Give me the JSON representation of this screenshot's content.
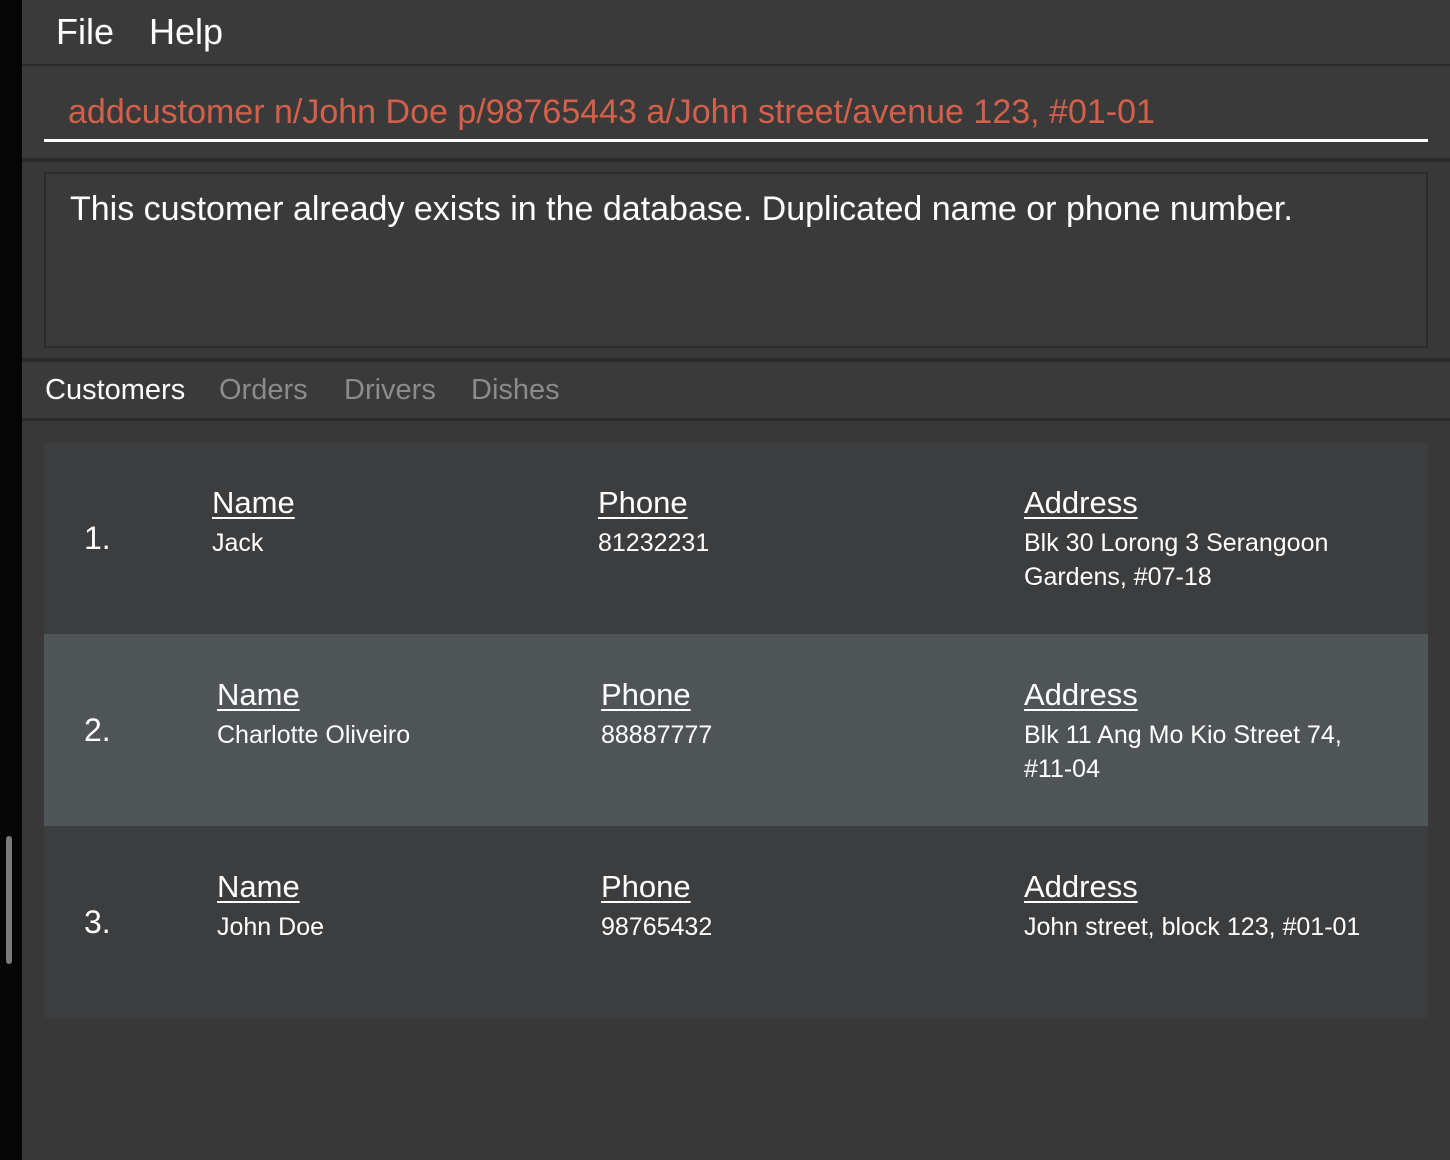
{
  "menu": {
    "file_label": "File",
    "help_label": "Help"
  },
  "command": {
    "value": "addcustomer n/John Doe p/98765443 a/John street/avenue 123, #01-01"
  },
  "result": {
    "message": "This customer already exists in the database. Duplicated name or phone number."
  },
  "tabs": [
    {
      "label": "Customers",
      "active": true
    },
    {
      "label": "Orders",
      "active": false
    },
    {
      "label": "Drivers",
      "active": false
    },
    {
      "label": "Dishes",
      "active": false
    }
  ],
  "headers": {
    "name": "Name",
    "phone": "Phone",
    "address": "Address"
  },
  "customers": [
    {
      "index": "1.",
      "name": "Jack",
      "phone": "81232231",
      "address": "Blk 30 Lorong 3 Serangoon Gardens, #07-18"
    },
    {
      "index": "2.",
      "name": "Charlotte Oliveiro",
      "phone": "88887777",
      "address": "Blk 11 Ang Mo Kio Street 74, #11-04"
    },
    {
      "index": "3.",
      "name": "John Doe",
      "phone": "98765432",
      "address": "John street, block 123, #01-01"
    }
  ],
  "colors": {
    "command_text": "#d3604a",
    "background": "#383838",
    "selected_row": "#4f5557"
  }
}
